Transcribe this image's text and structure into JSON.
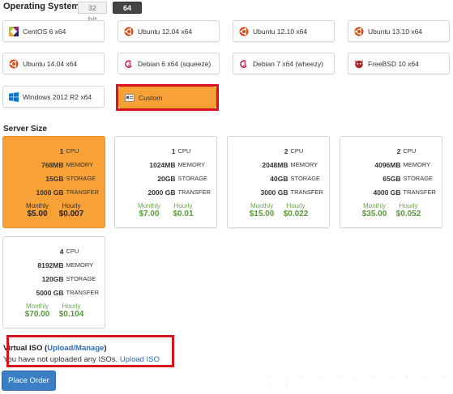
{
  "operating_system": {
    "title": "Operating System",
    "bit_32": "32 bit",
    "bit_64": "64 bit",
    "options": [
      {
        "label": "CentOS 6 x64",
        "icon": "centos-icon"
      },
      {
        "label": "Ubuntu 12.04 x64",
        "icon": "ubuntu-icon"
      },
      {
        "label": "Ubuntu 12.10 x64",
        "icon": "ubuntu-icon"
      },
      {
        "label": "Ubuntu 13.10 x64",
        "icon": "ubuntu-icon"
      },
      {
        "label": "Ubuntu 14.04 x64",
        "icon": "ubuntu-icon"
      },
      {
        "label": "Debian 6 x64 (squeeze)",
        "icon": "debian-icon"
      },
      {
        "label": "Debian 7 x64 (wheezy)",
        "icon": "debian-icon"
      },
      {
        "label": "FreeBSD 10 x64",
        "icon": "freebsd-icon"
      },
      {
        "label": "Windows 2012 R2 x64",
        "icon": "windows-icon"
      },
      {
        "label": "Custom",
        "icon": "custom-iso-icon",
        "selected": true
      }
    ]
  },
  "server_size": {
    "title": "Server Size",
    "cpu_unit": "CPU",
    "memory_unit": "MEMORY",
    "storage_unit": "STORAGE",
    "transfer_unit": "TRANSFER",
    "monthly_label": "Monthly",
    "hourly_label": "Hourly",
    "plans": [
      {
        "cpu": "1",
        "memory": "768MB",
        "storage": "15GB",
        "transfer": "1000 GB",
        "monthly": "$5.00",
        "hourly": "$0.007",
        "selected": true
      },
      {
        "cpu": "1",
        "memory": "1024MB",
        "storage": "20GB",
        "transfer": "2000 GB",
        "monthly": "$7.00",
        "hourly": "$0.01"
      },
      {
        "cpu": "2",
        "memory": "2048MB",
        "storage": "40GB",
        "transfer": "3000 GB",
        "monthly": "$15.00",
        "hourly": "$0.022"
      },
      {
        "cpu": "2",
        "memory": "4096MB",
        "storage": "65GB",
        "transfer": "4000 GB",
        "monthly": "$35.00",
        "hourly": "$0.052"
      },
      {
        "cpu": "4",
        "memory": "8192MB",
        "storage": "120GB",
        "transfer": "5000 GB",
        "monthly": "$70.00",
        "hourly": "$0.104"
      }
    ]
  },
  "virtual_iso": {
    "title": "Virtual ISO",
    "open_paren": "(",
    "manage_link": "Upload/Manage",
    "close_paren": ")",
    "message": "You have not uploaded any ISOs.",
    "upload_link": "Upload ISO"
  },
  "actions": {
    "place_order": "Place Order"
  },
  "colors": {
    "selected": "#f7a136",
    "highlight_box": "#d9141f",
    "price_green": "#5a9a3c",
    "link_blue": "#2a6ebb",
    "button_blue": "#3b7fc4"
  }
}
